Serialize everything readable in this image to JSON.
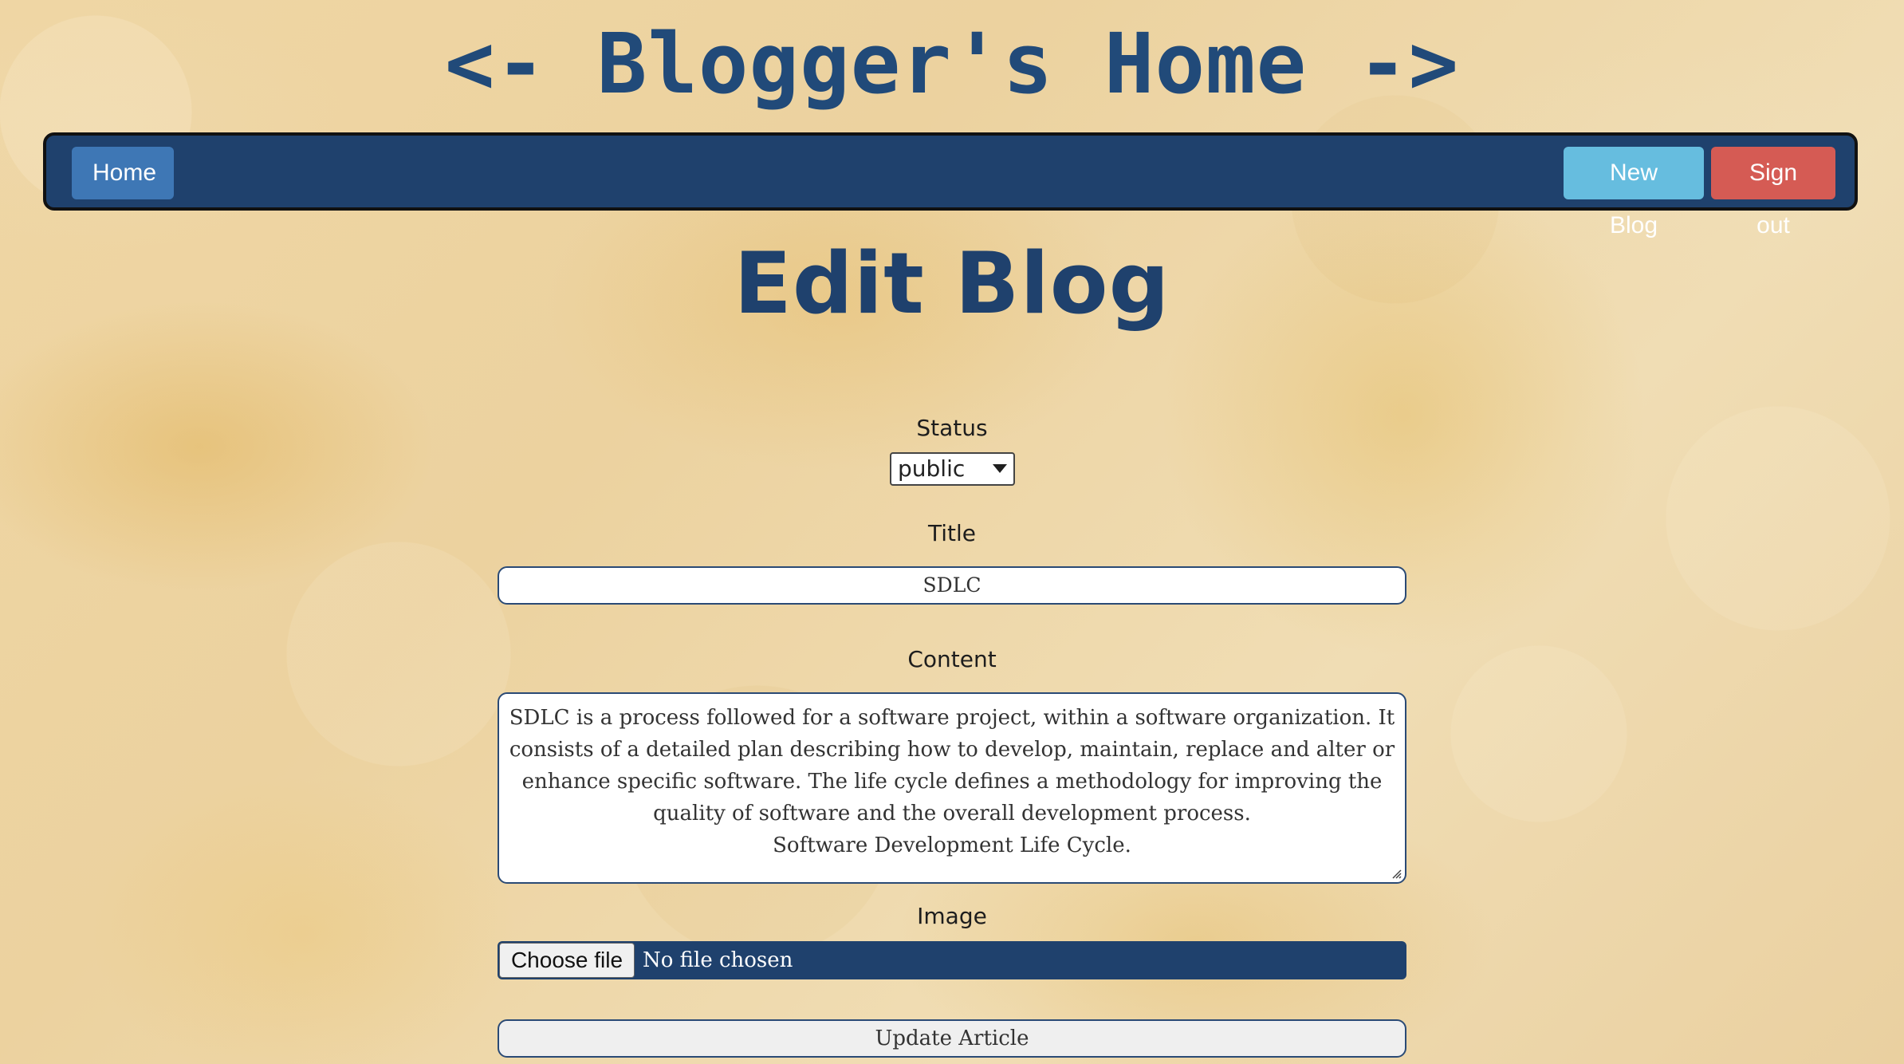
{
  "header": {
    "title": "<- Blogger's Home ->"
  },
  "nav": {
    "home": "Home",
    "new_blog": "New Blog",
    "sign_out": "Sign out"
  },
  "page": {
    "title": "Edit Blog"
  },
  "form": {
    "status": {
      "label": "Status",
      "value": "public"
    },
    "title": {
      "label": "Title",
      "value": "SDLC"
    },
    "content": {
      "label": "Content",
      "value": "SDLC is a process followed for a software project, within a software organization. It consists of a detailed plan describing how to develop, maintain, replace and alter or enhance specific software. The life cycle defines a methodology for improving the quality of software and the overall development process.\nSoftware Development Life Cycle."
    },
    "image": {
      "label": "Image",
      "choose_file": "Choose file",
      "status": "No file chosen"
    },
    "submit": "Update Article"
  }
}
